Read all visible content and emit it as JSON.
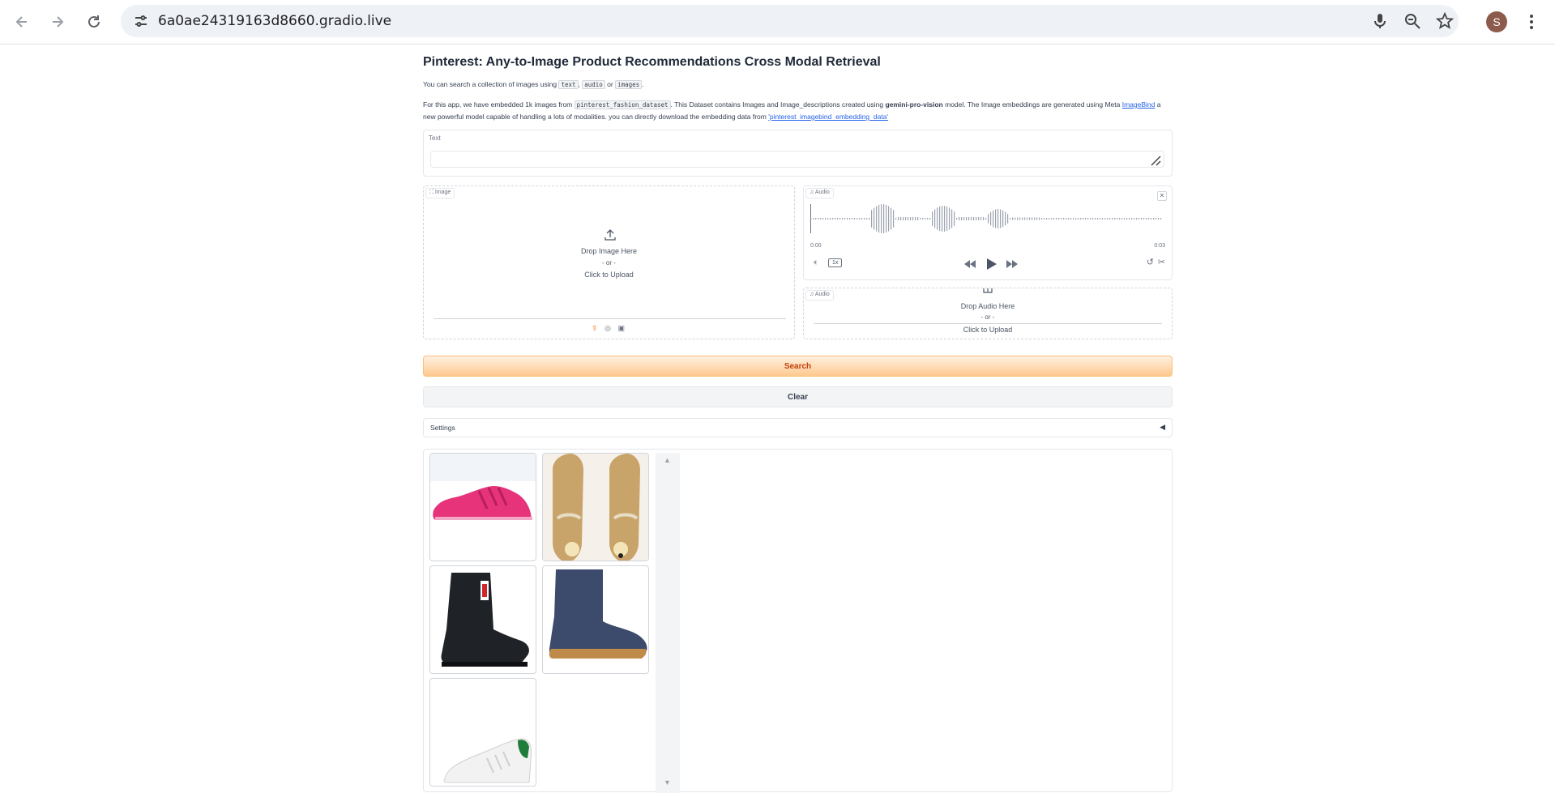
{
  "browser": {
    "url": "6a0ae24319163d8660.gradio.live",
    "avatar_letter": "S",
    "icons": [
      "back-arrow-icon",
      "forward-arrow-icon",
      "reload-icon",
      "site-settings-icon",
      "microphone-icon",
      "zoom-icon",
      "bookmark-star-icon",
      "kebab-menu-icon"
    ]
  },
  "app": {
    "title": "Pinterest: Any-to-Image Product Recommendations Cross Modal Retrieval",
    "intro": {
      "prefix": "You can search a collection of images using ",
      "code_text": "text",
      "sep1": ", ",
      "code_audio": "audio",
      "or": " or ",
      "code_images": "images",
      "suffix": "."
    },
    "about": {
      "part1": "For this app, we have embedded 1k images from ",
      "dataset_code": "pinterest_fashion_dataset",
      "part2": ". This Dataset contains Images and Image_descriptions created using ",
      "model_bold": "gemini-pro-vision",
      "part3": " model. The Image embeddings are generated using Meta ",
      "imagebind_link": "ImageBind",
      "part4": " a new powerful model capable of handling a lots of modalities. you can directly download the embedding data from ",
      "embedding_link": "'pinterest_imagebind_embedding_data'"
    },
    "text_block": {
      "label": "Text",
      "value": ""
    },
    "image_block": {
      "tag": "Image",
      "drop": "Drop Image Here",
      "or": "- or -",
      "click": "Click to Upload"
    },
    "audio_player": {
      "tag": "Audio",
      "time_start": "0:00",
      "time_end": "0:03",
      "speed": "1x"
    },
    "audio_upload": {
      "tag": "Audio",
      "drop": "Drop Audio Here",
      "or": "- or -",
      "click": "Click to Upload"
    },
    "search_label": "Search",
    "clear_label": "Clear",
    "settings_label": "Settings",
    "gallery": {
      "items": [
        "pink-sneaker",
        "gold-sandals",
        "black-rain-boot",
        "navy-suede-boot",
        "white-sneaker"
      ]
    }
  },
  "colors": {
    "accent": "#fdc98f",
    "accent_text": "#c2410c",
    "link": "#2563eb"
  }
}
